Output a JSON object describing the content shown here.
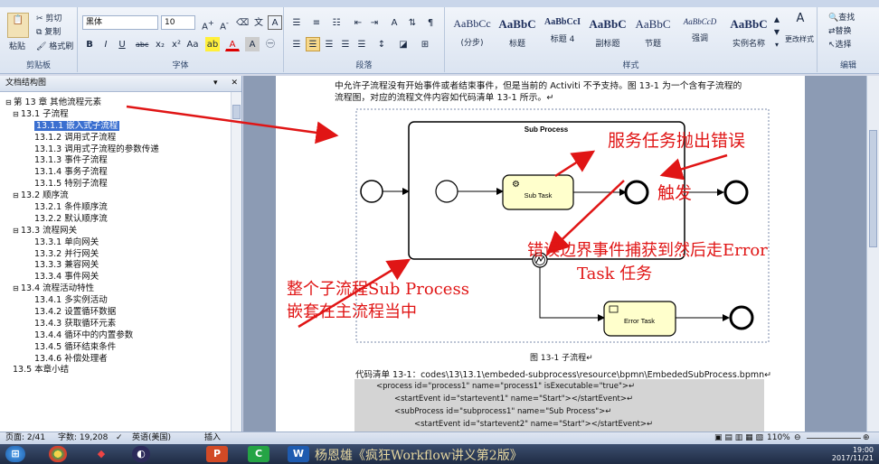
{
  "ribbon": {
    "clipboard": {
      "paste": "粘贴",
      "cut": "剪切",
      "copy": "复制",
      "format_painter": "格式刷",
      "title": "剪贴板"
    },
    "font": {
      "name": "黑体",
      "size": "10",
      "title": "字体"
    },
    "paragraph": {
      "title": "段落"
    },
    "styles": {
      "title": "样式",
      "items": [
        {
          "sample": "AaBbCc",
          "name": "(分步)"
        },
        {
          "sample": "AaBbC",
          "name": "标题"
        },
        {
          "sample": "AaBbCcI",
          "name": "标题 4"
        },
        {
          "sample": "AaBbC",
          "name": "副标题"
        },
        {
          "sample": "AaBbC",
          "name": "节题"
        },
        {
          "sample": "AaBbCcD",
          "name": "强调"
        },
        {
          "sample": "AaBbC",
          "name": "实例名称"
        }
      ],
      "change_styles": "更改样式"
    },
    "editing": {
      "title": "编辑",
      "find": "查找",
      "replace": "替换",
      "select": "选择"
    }
  },
  "nav": {
    "title": "文档结构图",
    "tree": [
      {
        "level": 0,
        "toggle": "⊟",
        "label": "第 13 章  其他流程元素"
      },
      {
        "level": 1,
        "toggle": "⊟",
        "label": "13.1  子流程"
      },
      {
        "level": 2,
        "label": "13.1.1  嵌入式子流程",
        "selected": true
      },
      {
        "level": 2,
        "label": "13.1.2  调用式子流程"
      },
      {
        "level": 2,
        "label": "13.1.3  调用式子流程的参数传递"
      },
      {
        "level": 2,
        "label": "13.1.3  事件子流程"
      },
      {
        "level": 2,
        "label": "13.1.4  事务子流程"
      },
      {
        "level": 2,
        "label": "13.1.5  特别子流程"
      },
      {
        "level": 1,
        "toggle": "⊟",
        "label": "13.2  顺序流"
      },
      {
        "level": 2,
        "label": "13.2.1  条件顺序流"
      },
      {
        "level": 2,
        "label": "13.2.2  默认顺序流"
      },
      {
        "level": 1,
        "toggle": "⊟",
        "label": "13.3  流程网关"
      },
      {
        "level": 2,
        "label": "13.3.1  单向网关"
      },
      {
        "level": 2,
        "label": "13.3.2  并行网关"
      },
      {
        "level": 2,
        "label": "13.3.3  兼容网关"
      },
      {
        "level": 2,
        "label": "13.3.4  事件网关"
      },
      {
        "level": 1,
        "toggle": "⊟",
        "label": "13.4  流程活动特性"
      },
      {
        "level": 2,
        "label": "13.4.1  多实例活动"
      },
      {
        "level": 2,
        "label": "13.4.2  设置循环数据"
      },
      {
        "level": 2,
        "label": "13.4.3  获取循环元素"
      },
      {
        "level": 2,
        "label": "13.4.4  循环中的内置参数"
      },
      {
        "level": 2,
        "label": "13.4.5  循环结束条件"
      },
      {
        "level": 2,
        "label": "13.4.6  补偿处理者"
      },
      {
        "level": 1,
        "label": "13.5  本章小结"
      }
    ]
  },
  "doc": {
    "para1": "中允许子流程没有开始事件或者结束事件，但是当前的 Activiti 不予支持。图 13-1 为一个含有子流程的",
    "para2": "流程图，对应的流程文件内容如代码清单 13-1 所示。↵",
    "diagram": {
      "subprocess_label": "Sub Process",
      "subtask_label": "Sub Task",
      "errortask_label": "Error Task"
    },
    "caption": "图 13-1  子流程↵",
    "listing_title": "代码清单 13-1：codes\\13\\13.1\\embeded-subprocess\\resource\\bpmn\\EmbededSubProcess.bpmn↵",
    "code": [
      "<process id=\"process1\" name=\"process1\" isExecutable=\"true\">↵",
      "<startEvent id=\"startevent1\" name=\"Start\"></startEvent>↵",
      "<subProcess id=\"subprocess1\" name=\"Sub Process\">↵",
      "<startEvent id=\"startevent2\" name=\"Start\"></startEvent>↵"
    ]
  },
  "annotations": {
    "service_error": "服务任务抛出错误",
    "trigger": "触发",
    "boundary_line1": "错误边界事件捕获到然后走Error",
    "boundary_line2": "Task 任务",
    "nested_line1": "整个子流程Sub Process",
    "nested_line2": "嵌套在主流程当中"
  },
  "status": {
    "page": "页面: 2/41",
    "words": "字数: 19,208",
    "language": "英语(美国)",
    "insert": "插入",
    "zoom": "110%"
  },
  "taskbar": {
    "window_title": "杨恩雄《疯狂Workflow讲义第2版》",
    "time": "19:00",
    "date": "2017/11/21"
  },
  "colors": {
    "annotation_red": "#e01515",
    "selection_blue": "#3a6fd0",
    "task_fill": "#ffffcc"
  }
}
